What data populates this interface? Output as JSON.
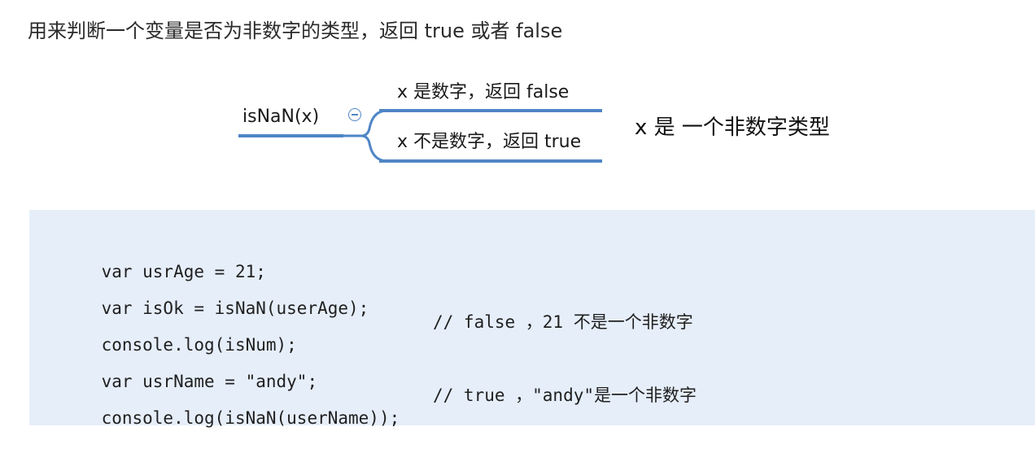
{
  "intro": {
    "text": "用来判断一个变量是否为非数字的类型，返回 true 或者 false"
  },
  "mindmap": {
    "root": "isNaN(x)",
    "branches": [
      "x 是数字，返回 false",
      "x 不是数字，返回 true"
    ],
    "summary": "x 是 一个非数字类型",
    "accent_color": "#4f86c6"
  },
  "code": {
    "background": "#e6eefa",
    "lines": [
      {
        "code": "var usrAge = 21;",
        "comment": ""
      },
      {
        "code": "var isOk = isNaN(userAge);",
        "comment": ""
      },
      {
        "code": "console.log(isNum);",
        "comment": "// false ，21 不是一个非数字"
      },
      {
        "code": "var usrName = \"andy\";",
        "comment": ""
      },
      {
        "code": "console.log(isNaN(userName));",
        "comment": "// true ，\"andy\"是一个非数字"
      }
    ]
  }
}
